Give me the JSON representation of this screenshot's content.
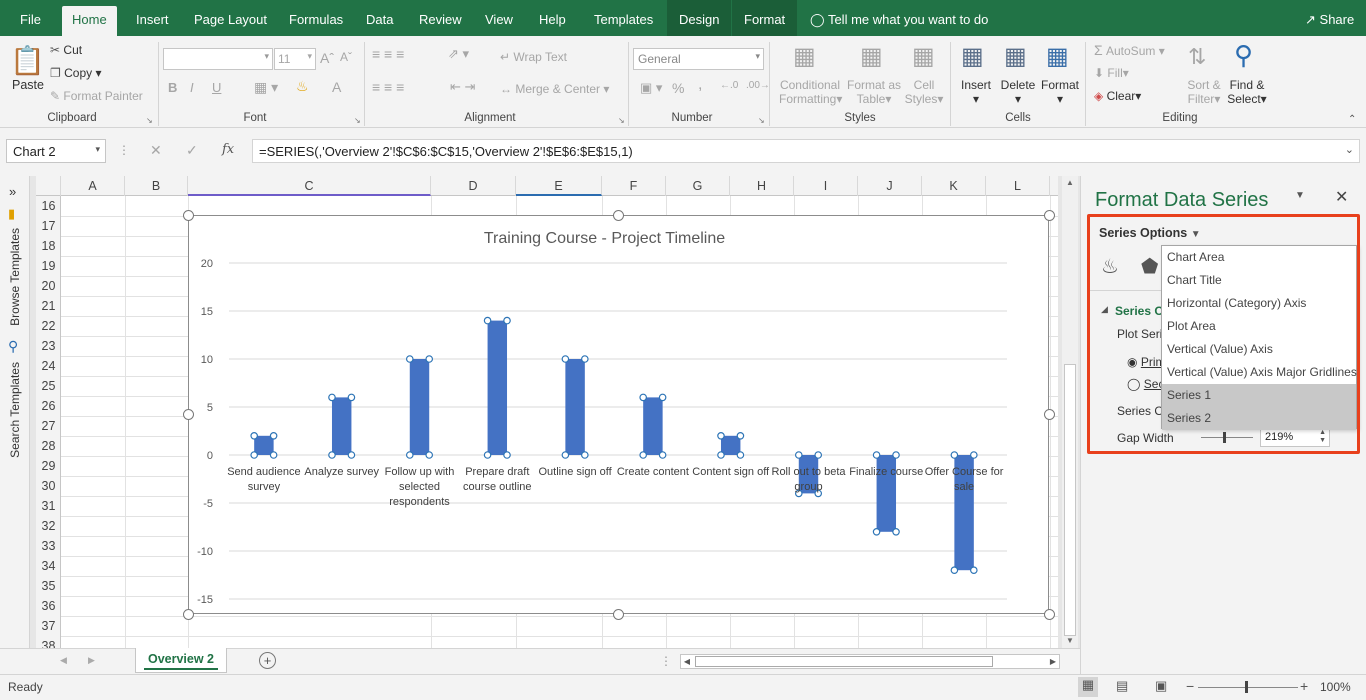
{
  "tabs": [
    {
      "label": "File"
    },
    {
      "label": "Home"
    },
    {
      "label": "Insert"
    },
    {
      "label": "Page Layout"
    },
    {
      "label": "Formulas"
    },
    {
      "label": "Data"
    },
    {
      "label": "Review"
    },
    {
      "label": "View"
    },
    {
      "label": "Help"
    },
    {
      "label": "Templates"
    },
    {
      "label": "Design"
    },
    {
      "label": "Format"
    }
  ],
  "tell_me": "Tell me what you want to do",
  "share": "Share",
  "ribbon": {
    "clipboard": {
      "paste": "Paste",
      "cut": "Cut",
      "copy": "Copy",
      "format_painter": "Format Painter",
      "label": "Clipboard"
    },
    "font": {
      "size": "11",
      "label": "Font",
      "bold": "B",
      "italic": "I",
      "underline": "U",
      "font_color": "A"
    },
    "alignment": {
      "wrap": "Wrap Text",
      "merge": "Merge & Center",
      "label": "Alignment"
    },
    "number": {
      "format": "General",
      "label": "Number",
      "percent": "%",
      "comma": ","
    },
    "styles": {
      "conditional": "Conditional",
      "formatting": "Formatting",
      "format_as": "Format as",
      "table": "Table",
      "cell": "Cell",
      "cell_styles": "Styles",
      "label": "Styles"
    },
    "cells": {
      "insert": "Insert",
      "delete": "Delete",
      "format": "Format",
      "label": "Cells"
    },
    "editing": {
      "autosum": "AutoSum",
      "fill": "Fill",
      "clear": "Clear",
      "sort": "Sort &",
      "filter": "Filter",
      "find": "Find &",
      "select": "Select",
      "label": "Editing"
    }
  },
  "formula_bar": {
    "name_box": "Chart 2",
    "fx": "fx",
    "formula": "=SERIES(,'Overview 2'!$C$6:$C$15,'Overview 2'!$E$6:$E$15,1)"
  },
  "left_strip": {
    "browse": "Browse Templates",
    "search": "Search Templates"
  },
  "columns": [
    "A",
    "B",
    "C",
    "D",
    "E",
    "F",
    "G",
    "H",
    "I",
    "J",
    "K",
    "L"
  ],
  "rows": [
    "16",
    "17",
    "18",
    "19",
    "20",
    "21",
    "22",
    "23",
    "24",
    "25",
    "26",
    "27",
    "28",
    "29",
    "30",
    "31",
    "32",
    "33",
    "34",
    "35",
    "36",
    "37",
    "38"
  ],
  "chart_data": {
    "type": "bar",
    "title": "Training Course - Project Timeline",
    "categories": [
      "Send audience survey",
      "Analyze survey",
      "Follow up with selected respondents",
      "Prepare draft course outline",
      "Outline sign off",
      "Create content",
      "Content sign off",
      "Roll out to beta group",
      "Finalize course",
      "Offer Course for sale"
    ],
    "category_lines": [
      [
        "Send audience",
        "survey"
      ],
      [
        "Analyze survey"
      ],
      [
        "Follow up with",
        "selected",
        "respondents"
      ],
      [
        "Prepare draft",
        "course outline"
      ],
      [
        "Outline sign off"
      ],
      [
        "Create content"
      ],
      [
        "Content sign off"
      ],
      [
        "Roll out to beta",
        "group"
      ],
      [
        "Finalize course"
      ],
      [
        "Offer Course for",
        "sale"
      ]
    ],
    "values": [
      2,
      6,
      10,
      14,
      10,
      6,
      2,
      -4,
      -8,
      -12
    ],
    "ylim": [
      -15,
      20
    ],
    "yticks": [
      20,
      15,
      10,
      5,
      0,
      -5,
      -10,
      -15
    ],
    "grid": true,
    "bar_color": "#4472c4"
  },
  "sheet_tab": "Overview 2",
  "status": {
    "ready": "Ready",
    "zoom": "100%",
    "minus": "−",
    "plus": "+"
  },
  "pane": {
    "title": "Format Data Series",
    "series_options": "Series Options",
    "section": "Series O",
    "plot_series": "Plot Seri",
    "primary": "Prim",
    "secondary": "Sec",
    "series_overlap": "Series Ov",
    "gap_width": "Gap Width",
    "gap_value": "219%",
    "dropdown": [
      "Chart Area",
      "Chart Title",
      "Horizontal (Category) Axis",
      "Plot Area",
      "Vertical (Value) Axis",
      "Vertical (Value) Axis Major Gridlines",
      "Series 1",
      "Series 2"
    ]
  },
  "colors": {
    "excel_green": "#217346",
    "highlight": "#e8401c"
  }
}
